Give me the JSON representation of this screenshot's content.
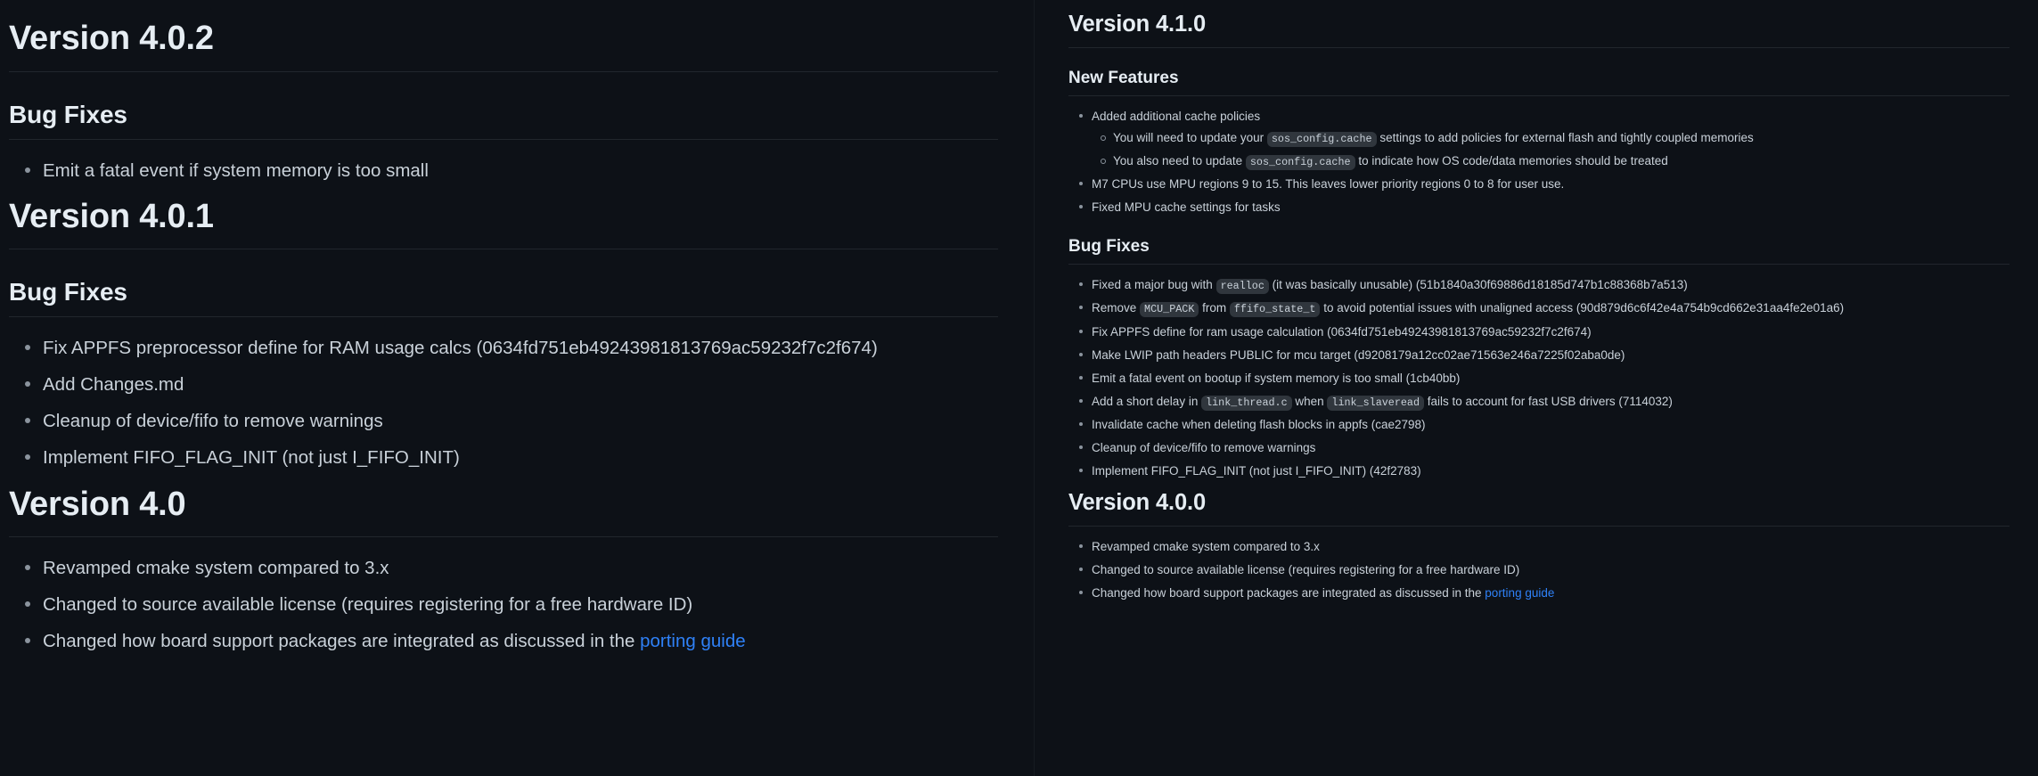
{
  "theme": {
    "background": "#0d1117",
    "text": "#c9d1d9",
    "heading": "#e6edf3",
    "rule": "#21262d",
    "code_bg": "#30363d",
    "link": "#2f81f7",
    "bullet": "#8b949e"
  },
  "left_pane": {
    "sections": [
      {
        "version_title": "Version 4.0.2",
        "subsections": [
          {
            "heading": "Bug Fixes",
            "items": [
              "Emit a fatal event if system memory is too small"
            ]
          }
        ]
      },
      {
        "version_title": "Version 4.0.1",
        "subsections": [
          {
            "heading": "Bug Fixes",
            "items": [
              "Fix APPFS preprocessor define for RAM usage calcs (0634fd751eb49243981813769ac59232f7c2f674)",
              "Add Changes.md",
              "Cleanup of device/fifo to remove warnings",
              "Implement FIFO_FLAG_INIT (not just I_FIFO_INIT)"
            ]
          }
        ]
      },
      {
        "version_title": "Version 4.0",
        "subsections": [
          {
            "heading": null,
            "items": [
              "Revamped cmake system compared to 3.x",
              "Changed to source available license (requires registering for a free hardware ID)"
            ],
            "link_item": {
              "text_before": "Changed how board support packages are integrated as discussed in the ",
              "link_label": "porting guide"
            }
          }
        ]
      }
    ]
  },
  "right_pane": {
    "version_410": {
      "version_title": "Version 4.1.0",
      "new_features_heading": "New Features",
      "new_features": {
        "item_1": "Added additional cache policies",
        "item_1_sub_1": {
          "before": "You will need to update your ",
          "code": "sos_config.cache",
          "after": " settings to add policies for external flash and tightly coupled memories"
        },
        "item_1_sub_2": {
          "before": "You also need to update ",
          "code": "sos_config.cache",
          "after": " to indicate how OS code/data memories should be treated"
        },
        "item_2": "M7 CPUs use MPU regions 9 to 15. This leaves lower priority regions 0 to 8 for user use.",
        "item_3": "Fixed MPU cache settings for tasks"
      },
      "bug_fixes_heading": "Bug Fixes",
      "bug_fixes": {
        "item_1": {
          "before": "Fixed a major bug with ",
          "code": "realloc",
          "after": " (it was basically unusable) (51b1840a30f69886d18185d747b1c88368b7a513)"
        },
        "item_2": {
          "before": "Remove ",
          "code": "MCU_PACK",
          "middle": " from ",
          "code2": "ffifo_state_t",
          "after": " to avoid potential issues with unaligned access (90d879d6c6f42e4a754b9cd662e31aa4fe2e01a6)"
        },
        "item_3": "Fix APPFS define for ram usage calculation (0634fd751eb49243981813769ac59232f7c2f674)",
        "item_4": "Make LWIP path headers PUBLIC for mcu target (d9208179a12cc02ae71563e246a7225f02aba0de)",
        "item_5": "Emit a fatal event on bootup if system memory is too small (1cb40bb)",
        "item_6": {
          "before": "Add a short delay in ",
          "code": "link_thread.c",
          "middle": " when ",
          "code2": "link_slaveread",
          "after": " fails to account for fast USB drivers (7114032)"
        },
        "item_7": "Invalidate cache when deleting flash blocks in appfs (cae2798)",
        "item_8": "Cleanup of device/fifo to remove warnings",
        "item_9": "Implement FIFO_FLAG_INIT (not just I_FIFO_INIT) (42f2783)"
      }
    },
    "version_400": {
      "version_title": "Version 4.0.0",
      "items": {
        "item_1": "Revamped cmake system compared to 3.x",
        "item_2": "Changed to source available license (requires registering for a free hardware ID)",
        "item_3": {
          "before": "Changed how board support packages are integrated as discussed in the ",
          "link_label": "porting guide"
        }
      }
    }
  }
}
